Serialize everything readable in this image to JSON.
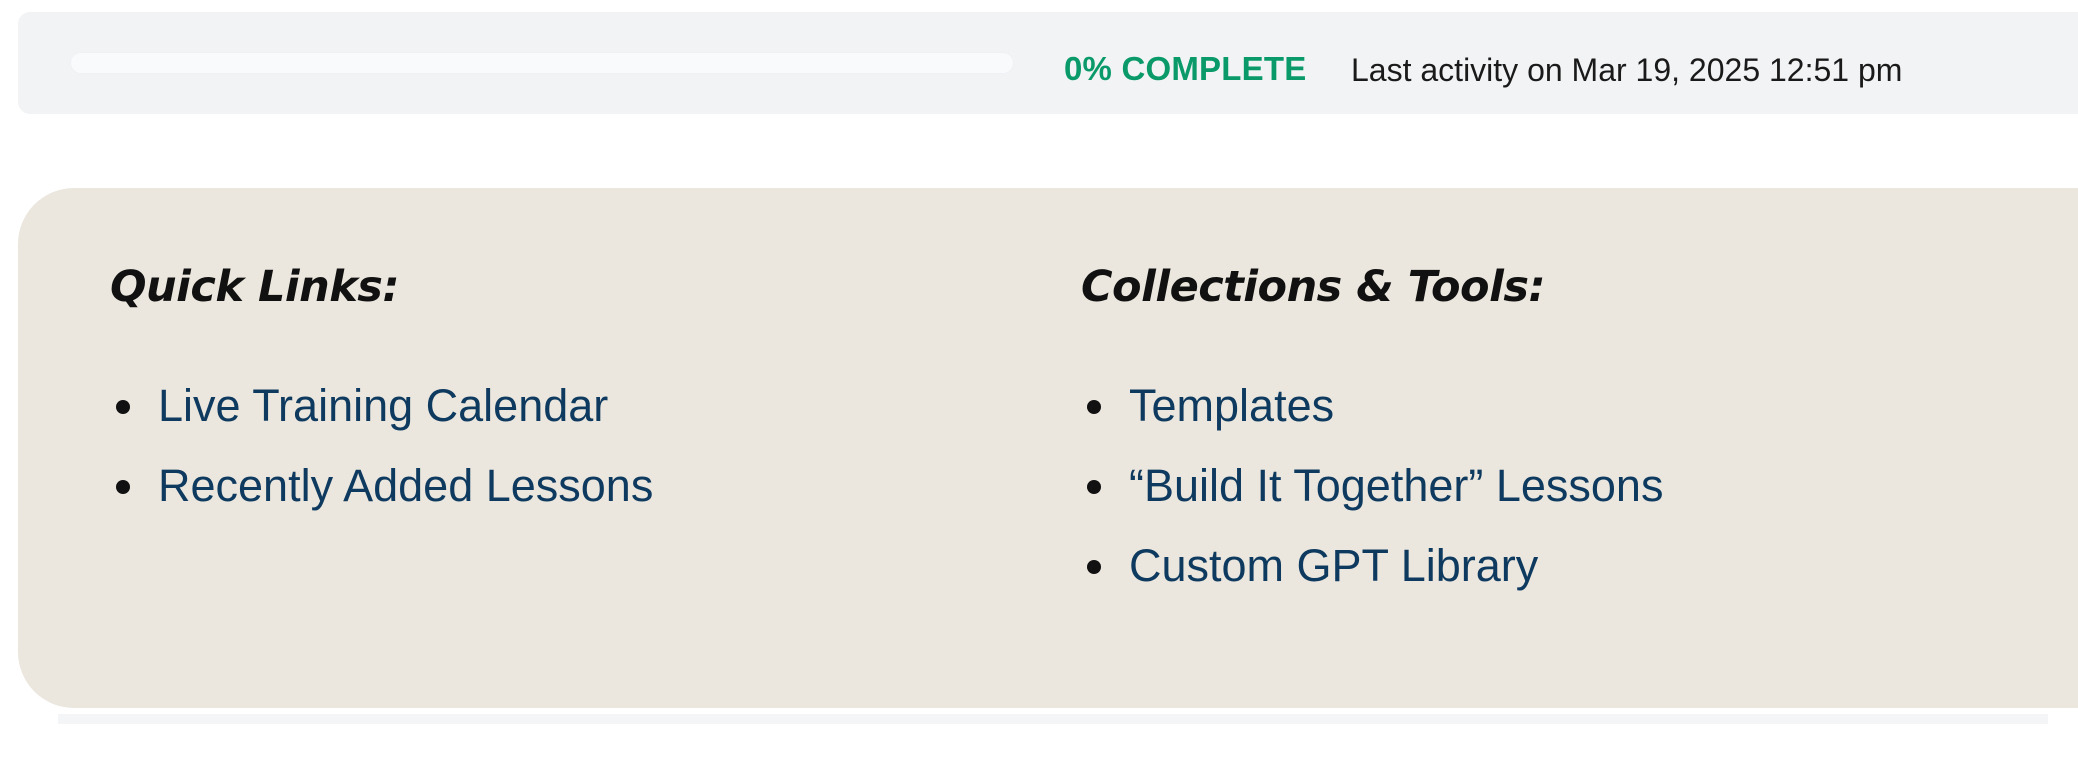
{
  "progress": {
    "percent_label": "0% COMPLETE",
    "percent_value": 0,
    "activity_text": "Last activity on Mar 19, 2025 12:51 pm",
    "accent_color": "#0a9a6a"
  },
  "quick_links": {
    "heading": "Quick Links:",
    "items": [
      {
        "label": "Live Training Calendar"
      },
      {
        "label": "Recently Added Lessons"
      }
    ]
  },
  "collections": {
    "heading": "Collections & Tools:",
    "items": [
      {
        "label": "Templates"
      },
      {
        "label": "“Build It Together” Lessons"
      },
      {
        "label": "Custom GPT Library"
      }
    ]
  },
  "colors": {
    "card_background": "#ebe7de",
    "link_color": "#0f3a5f"
  }
}
